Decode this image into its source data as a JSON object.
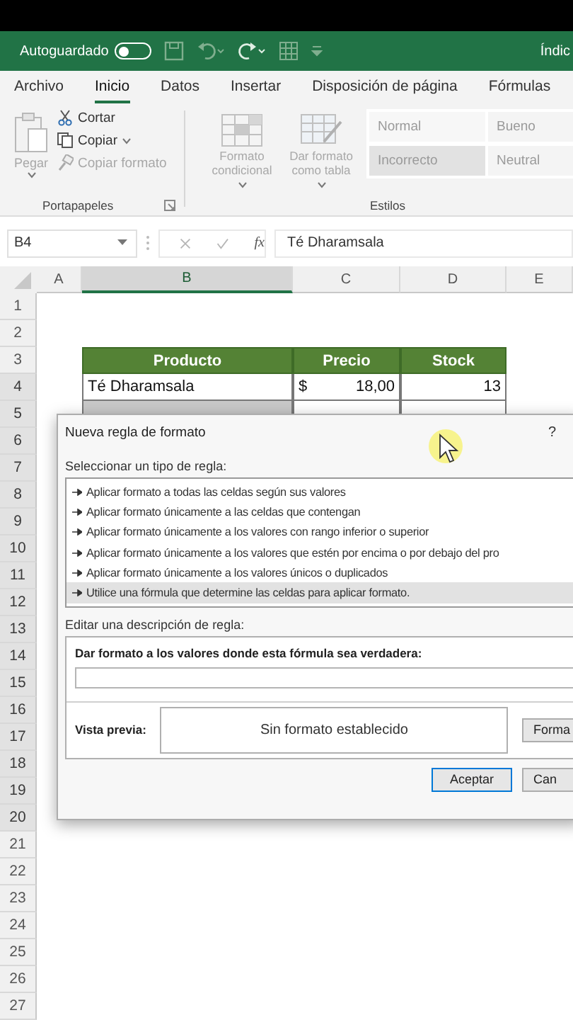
{
  "title_bar": {
    "autosave_label": "Autoguardado",
    "autosave_on": false,
    "title": "Índic"
  },
  "tabs": [
    {
      "label": "Archivo",
      "selected": false
    },
    {
      "label": "Inicio",
      "selected": true
    },
    {
      "label": "Datos",
      "selected": false
    },
    {
      "label": "Insertar",
      "selected": false
    },
    {
      "label": "Disposición de página",
      "selected": false
    },
    {
      "label": "Fórmulas",
      "selected": false
    }
  ],
  "ribbon": {
    "clipboard": {
      "label": "Portapapeles",
      "commands": [
        {
          "kind": "paste",
          "label": "Pegar",
          "disabled": true,
          "has_menu": true
        },
        {
          "kind": "cut",
          "label": "Cortar",
          "disabled": false,
          "has_menu": false
        },
        {
          "kind": "copy",
          "label": "Copiar",
          "disabled": false,
          "has_menu": true
        },
        {
          "kind": "format-painter",
          "label": "Copiar formato",
          "disabled": true,
          "has_menu": false
        }
      ]
    },
    "styles": {
      "label": "Estilos",
      "commands": [
        {
          "kind": "conditional-format",
          "label": "Formato condicional",
          "disabled": true,
          "has_menu": true
        },
        {
          "kind": "format-table",
          "label": "Dar formato como tabla",
          "disabled": true,
          "has_menu": true
        }
      ],
      "gallery": [
        {
          "kind": "normal",
          "label": "Normal"
        },
        {
          "kind": "good",
          "label": "Bueno"
        },
        {
          "kind": "bad",
          "label": "Incorrecto"
        },
        {
          "kind": "neutral",
          "label": "Neutral"
        }
      ]
    }
  },
  "formula_bar": {
    "name_box": "B4",
    "function_label": "fx",
    "formula": "Té Dharamsala"
  },
  "sheet": {
    "columns": [
      {
        "label": "A",
        "selected": false
      },
      {
        "label": "B",
        "selected": true
      },
      {
        "label": "C",
        "selected": false
      },
      {
        "label": "D",
        "selected": false
      },
      {
        "label": "E",
        "selected": false
      }
    ],
    "rows": [
      {
        "label": "1",
        "selected": false,
        "kind": "blank"
      },
      {
        "label": "2",
        "selected": false,
        "kind": "blank"
      },
      {
        "label": "3",
        "selected": false,
        "kind": "table-header",
        "product": "Producto",
        "price": "Precio",
        "stock": "Stock"
      },
      {
        "label": "4",
        "selected": true,
        "kind": "table-row",
        "product": "Té Dharamsala",
        "currency": "$",
        "price": "18,00",
        "stock": "13",
        "shaded": false
      },
      {
        "label": "5",
        "selected": true,
        "kind": "table-row",
        "shaded": true
      },
      {
        "label": "6",
        "selected": true,
        "kind": "blank"
      },
      {
        "label": "7",
        "selected": true,
        "kind": "blank"
      },
      {
        "label": "8",
        "selected": true,
        "kind": "blank"
      },
      {
        "label": "9",
        "selected": true,
        "kind": "blank"
      },
      {
        "label": "10",
        "selected": true,
        "kind": "blank"
      },
      {
        "label": "11",
        "selected": true,
        "kind": "blank"
      },
      {
        "label": "12",
        "selected": true,
        "kind": "blank"
      },
      {
        "label": "13",
        "selected": true,
        "kind": "blank"
      },
      {
        "label": "14",
        "selected": true,
        "kind": "blank"
      },
      {
        "label": "15",
        "selected": true,
        "kind": "blank"
      },
      {
        "label": "16",
        "selected": true,
        "kind": "blank"
      },
      {
        "label": "17",
        "selected": true,
        "kind": "blank"
      },
      {
        "label": "18",
        "selected": true,
        "kind": "blank"
      },
      {
        "label": "19",
        "selected": true,
        "kind": "blank"
      },
      {
        "label": "20",
        "selected": true,
        "kind": "blank"
      },
      {
        "label": "21",
        "selected": false,
        "kind": "blank"
      },
      {
        "label": "22",
        "selected": false,
        "kind": "blank"
      },
      {
        "label": "23",
        "selected": false,
        "kind": "blank"
      },
      {
        "label": "24",
        "selected": false,
        "kind": "blank"
      },
      {
        "label": "25",
        "selected": false,
        "kind": "blank"
      },
      {
        "label": "26",
        "selected": false,
        "kind": "blank"
      },
      {
        "label": "27",
        "selected": false,
        "kind": "blank"
      }
    ]
  },
  "dialog": {
    "title": "Nueva regla de formato",
    "help": "?",
    "type_label": "Seleccionar un tipo de regla:",
    "rule_types": [
      {
        "label": "Aplicar formato a todas las celdas según sus valores",
        "selected": false
      },
      {
        "label": "Aplicar formato únicamente a las celdas que contengan",
        "selected": false
      },
      {
        "label": "Aplicar formato únicamente a los valores con rango inferior o superior",
        "selected": false
      },
      {
        "label": "Aplicar formato únicamente a los valores que estén por encima o por debajo del pro",
        "selected": false
      },
      {
        "label": "Aplicar formato únicamente a los valores únicos o duplicados",
        "selected": false
      },
      {
        "label": "Utilice una fórmula que determine las celdas para aplicar formato.",
        "selected": true
      }
    ],
    "description_label": "Editar una descripción de regla:",
    "formula_label": "Dar formato a los valores donde esta fórmula sea verdadera:",
    "preview_label": "Vista previa:",
    "preview_text": "Sin formato establecido",
    "format_button": "Forma",
    "buttons": [
      {
        "label": "Aceptar",
        "default": true
      },
      {
        "label": "Can",
        "default": false
      }
    ]
  }
}
